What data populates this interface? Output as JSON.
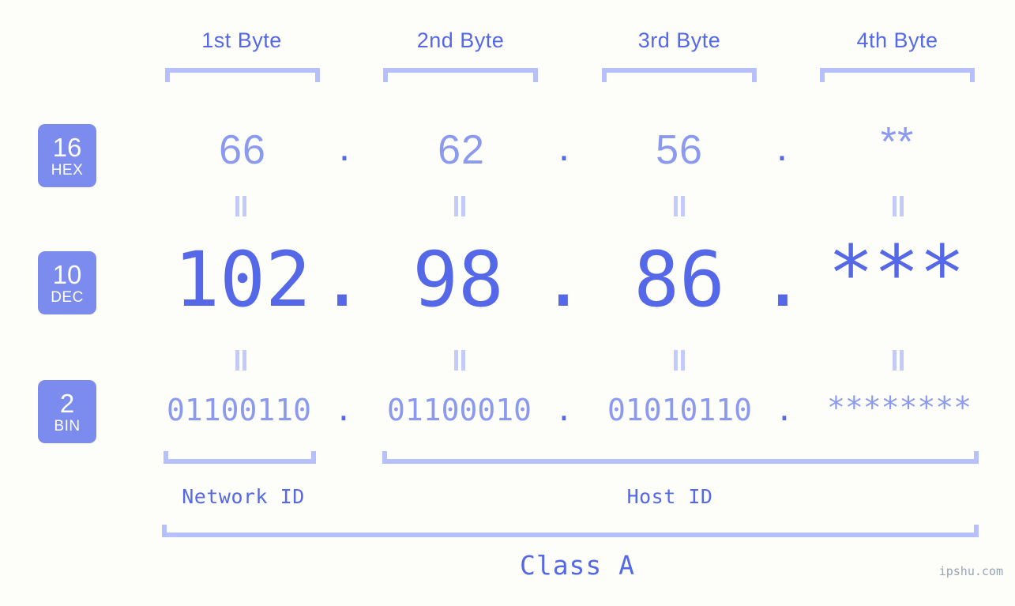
{
  "page": {
    "background_color": "#fdfefa",
    "accent_color": "#5468e8",
    "accent_light_color": "#8b9aee",
    "bracket_color": "#b6c0fb",
    "badge_color": "#7b8cee",
    "watermark": "ipshu.com"
  },
  "byte_headers": [
    {
      "label": "1st Byte"
    },
    {
      "label": "2nd Byte"
    },
    {
      "label": "3rd Byte"
    },
    {
      "label": "4th Byte"
    }
  ],
  "rows": {
    "hex": {
      "badge_number": "16",
      "badge_name": "HEX",
      "values": [
        "66",
        "62",
        "56",
        "**"
      ],
      "separator": "."
    },
    "dec": {
      "badge_number": "10",
      "badge_name": "DEC",
      "values": [
        "102",
        "98",
        "86",
        "***"
      ],
      "separator": "."
    },
    "bin": {
      "badge_number": "2",
      "badge_name": "BIN",
      "values": [
        "01100110",
        "01100010",
        "01010110",
        "********"
      ],
      "separator": "."
    }
  },
  "equals_marks": {
    "glyph": "||",
    "count_per_gap": 4
  },
  "sections": [
    {
      "label": "Network ID"
    },
    {
      "label": "Host ID"
    }
  ],
  "class": {
    "label": "Class A"
  }
}
